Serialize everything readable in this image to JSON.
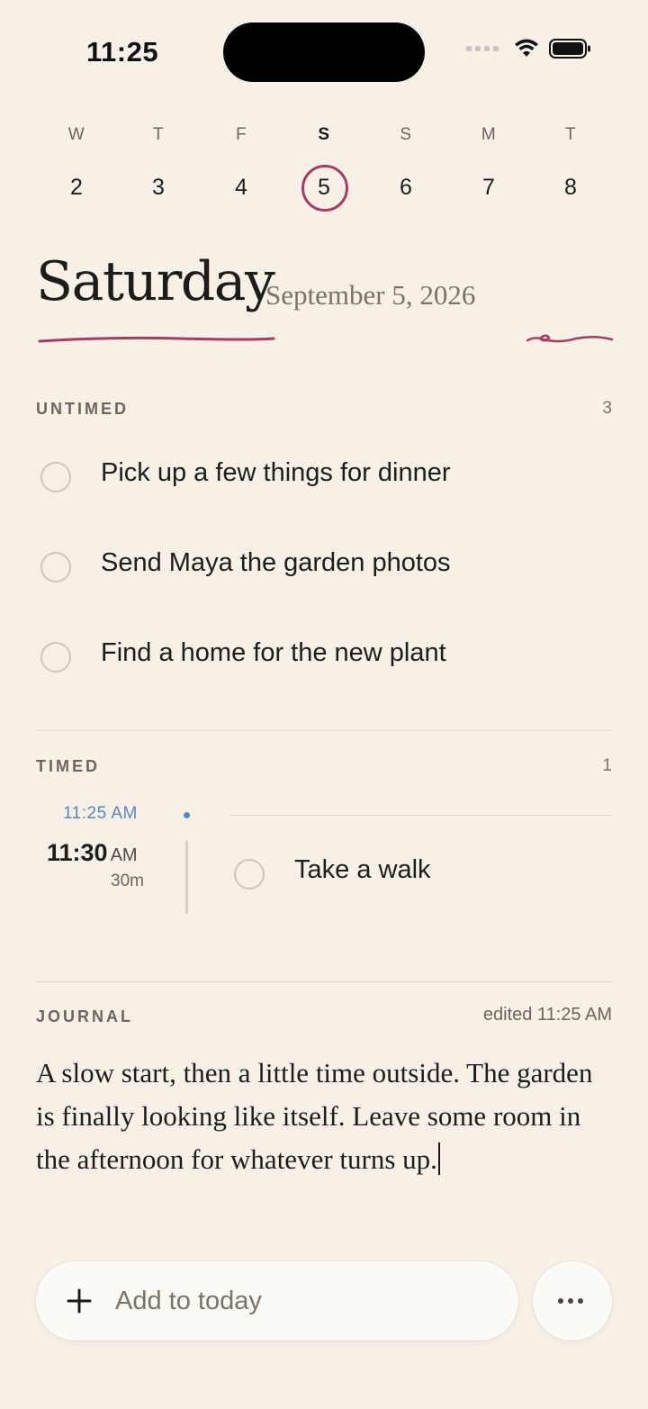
{
  "status_bar": {
    "time": "11:25"
  },
  "week": {
    "days": [
      {
        "letter": "W",
        "number": "2"
      },
      {
        "letter": "T",
        "number": "3"
      },
      {
        "letter": "F",
        "number": "4"
      },
      {
        "letter": "S",
        "number": "5",
        "selected": true
      },
      {
        "letter": "S",
        "number": "6"
      },
      {
        "letter": "M",
        "number": "7"
      },
      {
        "letter": "T",
        "number": "8"
      }
    ]
  },
  "header": {
    "day_name": "Saturday",
    "date": "September 5, 2026"
  },
  "untimed": {
    "label": "UNTIMED",
    "count": "3",
    "tasks": [
      {
        "text": "Pick up a few things for dinner"
      },
      {
        "text": "Send Maya the garden photos"
      },
      {
        "text": "Find a home for the new plant"
      }
    ]
  },
  "timed": {
    "label": "TIMED",
    "count": "1",
    "now_time": "11:25 AM",
    "items": [
      {
        "time": "11:30",
        "ampm": "AM",
        "duration": "30m",
        "text": "Take a walk"
      }
    ]
  },
  "journal": {
    "label": "JOURNAL",
    "edited": "edited 11:25 AM",
    "text": "A slow start, then a little time outside. The garden is finally looking like itself. Leave some room in the afternoon for whatever turns up."
  },
  "bottom": {
    "add_placeholder": "Add to today"
  },
  "colors": {
    "background": "#f6f0e7",
    "accent": "#a33d62",
    "now_blue": "#5d86b5"
  }
}
